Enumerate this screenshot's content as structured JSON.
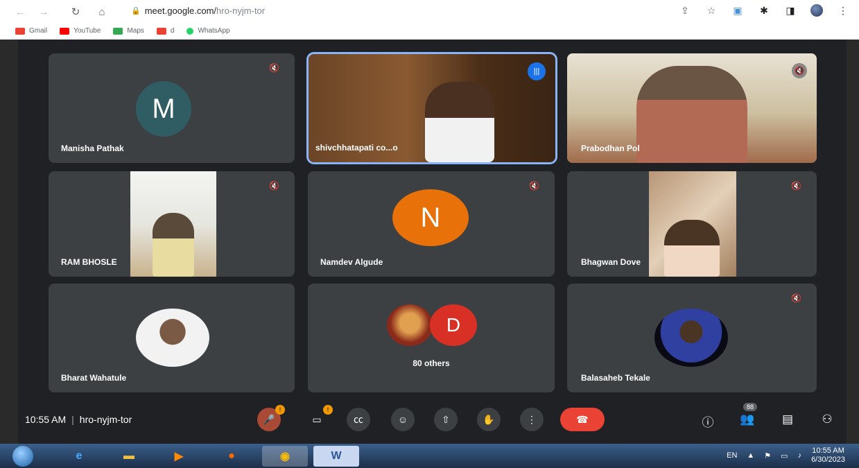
{
  "browser": {
    "url_domain": "meet.google.com/",
    "url_path": "hro-nyjm-tor",
    "bookmarks": [
      {
        "label": "Gmail",
        "color": "#ea4335"
      },
      {
        "label": "YouTube",
        "color": "#ff0000"
      },
      {
        "label": "Maps",
        "color": "#34a853"
      },
      {
        "label": "d",
        "color": "#ea4335"
      },
      {
        "label": "WhatsApp",
        "color": "#25d366"
      }
    ]
  },
  "tiles": [
    {
      "name": "Manisha Pathak",
      "initial": "M",
      "avatar_color": "#2f5d63"
    },
    {
      "name": "shivchhatapati co...o",
      "speaking": true
    },
    {
      "name": "Prabodhan Pol"
    },
    {
      "name": "RAM BHOSLE"
    },
    {
      "name": "Namdev Algude",
      "initial": "N",
      "avatar_color": "#e8710a"
    },
    {
      "name": "Bhagwan Dove"
    },
    {
      "name": "Bharat Wahatule"
    },
    {
      "name": "80 others",
      "initial": "D",
      "avatar_color": "#d93025"
    },
    {
      "name": "Balasaheb Tekale"
    }
  ],
  "bottom_bar": {
    "time": "10:55 AM",
    "meeting_code": "hro-nyjm-tor",
    "mic_badge": "!",
    "camera_badge": "!",
    "people_count": "88"
  },
  "taskbar": {
    "language": "EN",
    "time": "10:55 AM",
    "date": "6/30/2023"
  }
}
